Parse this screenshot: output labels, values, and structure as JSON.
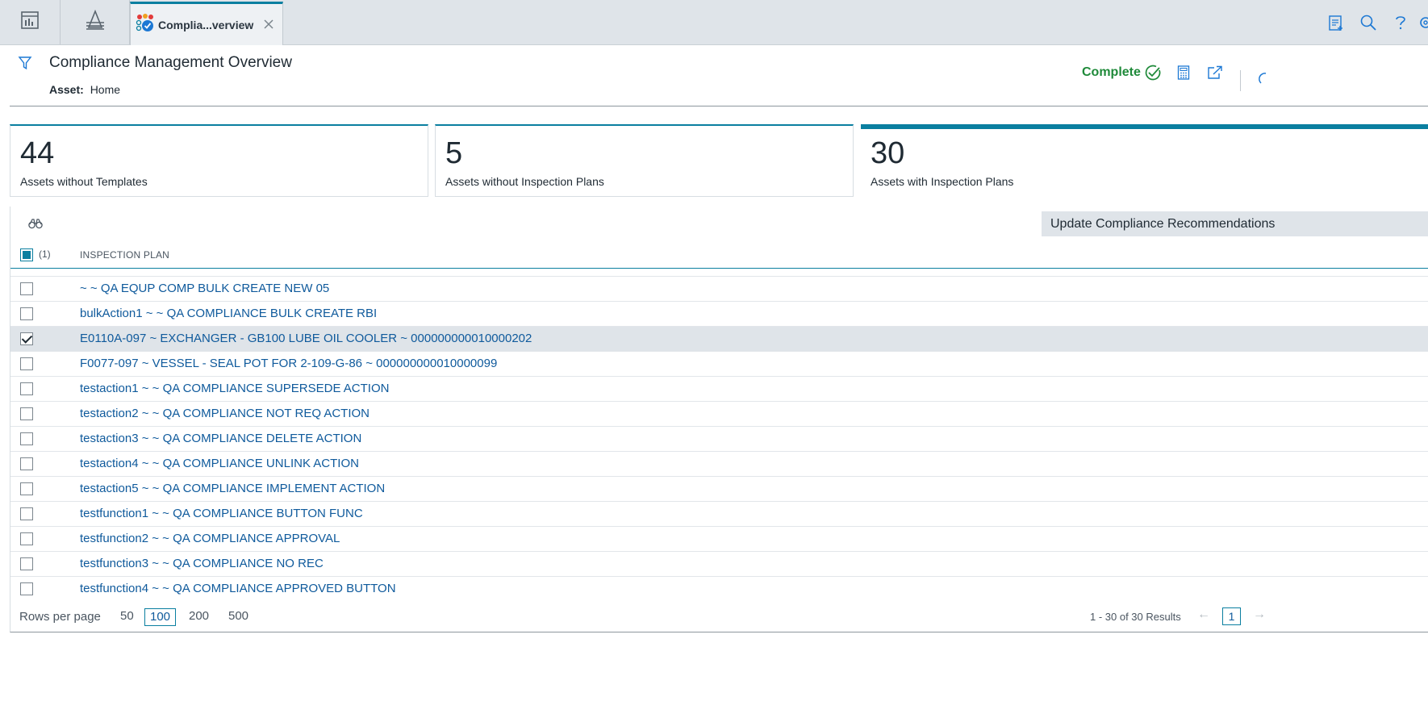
{
  "tabs": {
    "active_label": "Complia...verview"
  },
  "header": {
    "title": "Compliance Management Overview",
    "asset_label": "Asset:",
    "asset_value": "Home",
    "status": "Complete"
  },
  "cards": [
    {
      "count": "44",
      "label": "Assets without Templates"
    },
    {
      "count": "5",
      "label": "Assets without Inspection Plans"
    },
    {
      "count": "30",
      "label": "Assets with Inspection Plans"
    }
  ],
  "toolbar": {
    "update_button": "Update Compliance Recommendations"
  },
  "grid": {
    "selected_count": "(1)",
    "column_header": "INSPECTION PLAN",
    "rows": [
      {
        "text": "~ ~ QA EQUP COMP BULK CREATE NEW 05",
        "checked": false
      },
      {
        "text": "bulkAction1 ~ ~ QA COMPLIANCE BULK CREATE RBI",
        "checked": false
      },
      {
        "text": "E0110A-097 ~ EXCHANGER - GB100 LUBE OIL COOLER ~ 000000000010000202",
        "checked": true
      },
      {
        "text": "F0077-097 ~ VESSEL - SEAL POT FOR 2-109-G-86 ~ 000000000010000099",
        "checked": false
      },
      {
        "text": "testaction1 ~ ~ QA COMPLIANCE SUPERSEDE ACTION",
        "checked": false
      },
      {
        "text": "testaction2 ~ ~ QA COMPLIANCE NOT REQ ACTION",
        "checked": false
      },
      {
        "text": "testaction3 ~ ~ QA COMPLIANCE DELETE ACTION",
        "checked": false
      },
      {
        "text": "testaction4 ~ ~ QA COMPLIANCE UNLINK ACTION",
        "checked": false
      },
      {
        "text": "testaction5 ~ ~ QA COMPLIANCE IMPLEMENT ACTION",
        "checked": false
      },
      {
        "text": "testfunction1 ~ ~ QA COMPLIANCE BUTTON FUNC",
        "checked": false
      },
      {
        "text": "testfunction2 ~ ~ QA COMPLIANCE APPROVAL",
        "checked": false
      },
      {
        "text": "testfunction3 ~ ~ QA COMPLIANCE NO REC",
        "checked": false
      },
      {
        "text": "testfunction4 ~ ~ QA COMPLIANCE APPROVED BUTTON",
        "checked": false
      }
    ]
  },
  "pager": {
    "rows_per_page_label": "Rows per page",
    "options": [
      "50",
      "100",
      "200",
      "500"
    ],
    "selected_option": "100",
    "results": "1 - 30 of 30 Results",
    "page": "1"
  },
  "icons": {
    "nav": [
      "dashboard-icon",
      "asset-hierarchy-icon"
    ],
    "top_right": [
      "add-report-icon",
      "search-icon",
      "help-icon",
      "settings-icon"
    ],
    "header": [
      "filter-icon",
      "complete-check-icon",
      "calculator-icon",
      "open-external-icon",
      "refresh-icon"
    ]
  },
  "colors": {
    "accent": "#0a7fa0",
    "link": "#0f5a9c",
    "complete": "#1f8a3a",
    "tabbar": "#dfe4e9"
  }
}
